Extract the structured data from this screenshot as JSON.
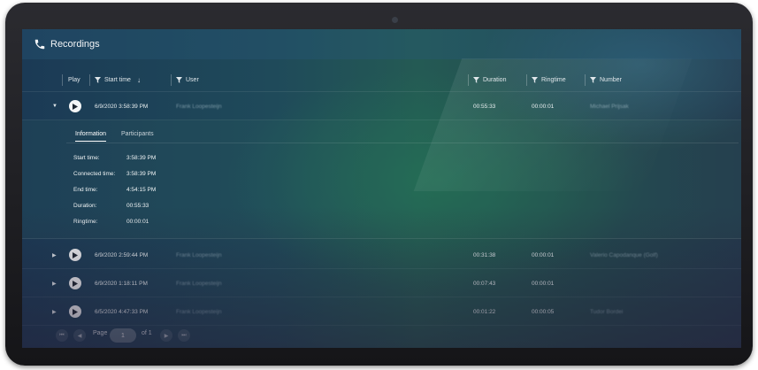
{
  "window": {
    "title": "Recordings"
  },
  "columns": {
    "play": "Play",
    "start_time": "Start time",
    "user": "User",
    "duration": "Duration",
    "ringtime": "Ringtime",
    "number": "Number"
  },
  "rows": [
    {
      "start": "6/9/2020 3:58:39 PM",
      "user": "Frank Loopesteijn",
      "duration": "00:55:33",
      "ringtime": "00:00:01",
      "number": "Michael Prijsak"
    },
    {
      "start": "6/9/2020 2:59:44 PM",
      "user": "Frank Loopesteijn",
      "duration": "00:31:38",
      "ringtime": "00:00:01",
      "number": "Valerio Capodanque (Golf)"
    },
    {
      "start": "6/9/2020 1:18:11 PM",
      "user": "Frank Loopesteijn",
      "duration": "00:07:43",
      "ringtime": "00:00:01",
      "number": ""
    },
    {
      "start": "6/5/2020 4:47:33 PM",
      "user": "Frank Loopesteijn",
      "duration": "00:01:22",
      "ringtime": "00:00:05",
      "number": "Tudor Bordei"
    }
  ],
  "detail": {
    "tabs": [
      "Information",
      "Participants"
    ],
    "fields": [
      {
        "label": "Start time:",
        "value": "3:58:39 PM"
      },
      {
        "label": "Connected time:",
        "value": "3:58:39 PM"
      },
      {
        "label": "End time:",
        "value": "4:54:15 PM"
      },
      {
        "label": "Duration:",
        "value": "00:55:33"
      },
      {
        "label": "Ringtime:",
        "value": "00:00:01"
      }
    ]
  },
  "pager": {
    "page_label": "Page",
    "current": "1",
    "of_label": "of 1"
  },
  "icons": {
    "title": "phone-icon",
    "filter": "funnel-icon",
    "sort": "arrow-down-icon",
    "play": "play-icon",
    "expanded": "caret-down-icon",
    "collapsed": "caret-right-icon"
  },
  "colors": {
    "accent": "#ffffff",
    "screen_bg": "#1f4a5a"
  }
}
